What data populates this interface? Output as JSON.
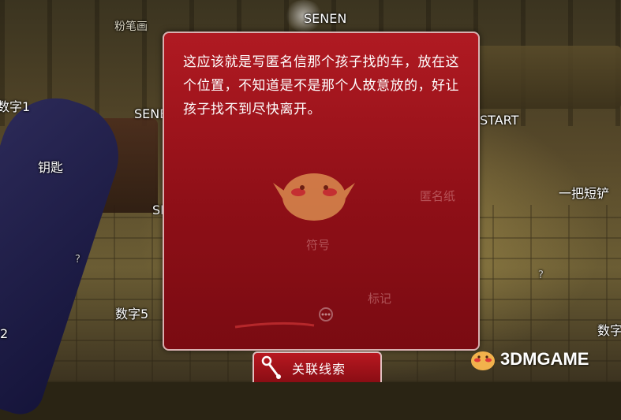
{
  "scene": {
    "labels": {
      "top_speaker": "SENEN",
      "chalk": "粉笔画",
      "digit1": "数字1",
      "senen_mid": "SENE",
      "key": "钥匙",
      "senen_low": "SEN",
      "start": "START",
      "shovel": "一把短铲",
      "anon_paper": "匿名纸",
      "symbol": "符号",
      "mark": "标记",
      "digit5": "数字5",
      "digit_right": "数字",
      "num2": "2",
      "q1": "?",
      "q2": "?"
    }
  },
  "dialog": {
    "text": "这应该就是写匿名信那个孩子找的车，放在这个位置，不知道是不是那个人故意放的，好让孩子找不到尽快离开。"
  },
  "action": {
    "label": "关联线索"
  },
  "watermark": {
    "brand": "3DMGAME"
  }
}
